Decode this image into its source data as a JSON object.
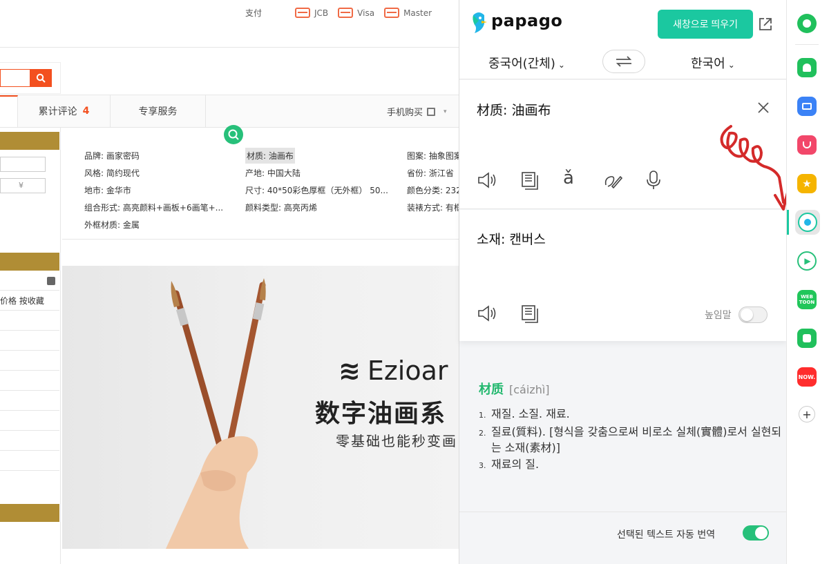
{
  "page": {
    "payment_label": "支付",
    "payments": [
      "JCB",
      "Visa",
      "Master"
    ],
    "tabs": [
      {
        "label": "累计评论",
        "count": "4"
      },
      {
        "label": "专享服务"
      }
    ],
    "mobile_buy": "手机购买",
    "price_placeholder": "¥",
    "sort_text": "价格 按收藏",
    "attributes": [
      "品牌: 画家密码",
      "材质: 油画布",
      "图案: 抽象图案",
      "风格: 简约现代",
      "产地: 中国大陆",
      "省份: 浙江省",
      "地市: 金华市",
      "尺寸: 40*50彩色厚框（无外框） 50...",
      "颜色分类: 232",
      "组合形式: 高亮颜料+画板+6画笔+...",
      "颜料类型: 高亮丙烯",
      "装裱方式: 有框",
      "外框材质: 金属"
    ],
    "banner": {
      "brand": "Ezioar",
      "title": "数字油画系",
      "subtitle": "零基础也能秒变画"
    }
  },
  "papago": {
    "logo": "papago",
    "new_window_label": "새창으로 띄우기",
    "source_lang": "중국어(간체)",
    "target_lang": "한국어",
    "source_text": "材质: 油画布",
    "pinyin_tool": "ǎ",
    "target_text": "소재: 캔버스",
    "honorific_label": "높임말",
    "dictionary": {
      "word": "材质",
      "pinyin": "[cáizhì]",
      "meanings": [
        {
          "num": "1.",
          "text": "재질. 소질. 재료."
        },
        {
          "num": "2.",
          "text": "질료(質料). [형식을 갖춤으로써 비로소 실체(實體)로서 실현되는 소재(素材)]"
        },
        {
          "num": "3.",
          "text": "재료의 질."
        }
      ]
    },
    "auto_translate_label": "선택된 텍스트 자동 번역"
  },
  "sidebar": {
    "items": [
      {
        "icon": "home-circle-icon",
        "color": "#20c05c"
      },
      {
        "icon": "bell-icon",
        "color": "#20c05c"
      },
      {
        "icon": "briefcase-icon",
        "color": "#3b82f6"
      },
      {
        "icon": "pocket-icon",
        "color": "#f2476a"
      },
      {
        "icon": "star-icon",
        "color": "#f5b400"
      },
      {
        "icon": "papago-icon",
        "color": "#1bc8a0"
      },
      {
        "icon": "play-icon",
        "color": "#27c07a"
      },
      {
        "icon": "webtoon-icon",
        "color": "#21c65a",
        "text": "WEB TOON"
      },
      {
        "icon": "square-icon",
        "color": "#20c05c"
      },
      {
        "icon": "now-icon",
        "color": "#ff2d2d",
        "text": "NOW."
      },
      {
        "icon": "plus-icon",
        "color": "#333333"
      }
    ]
  }
}
